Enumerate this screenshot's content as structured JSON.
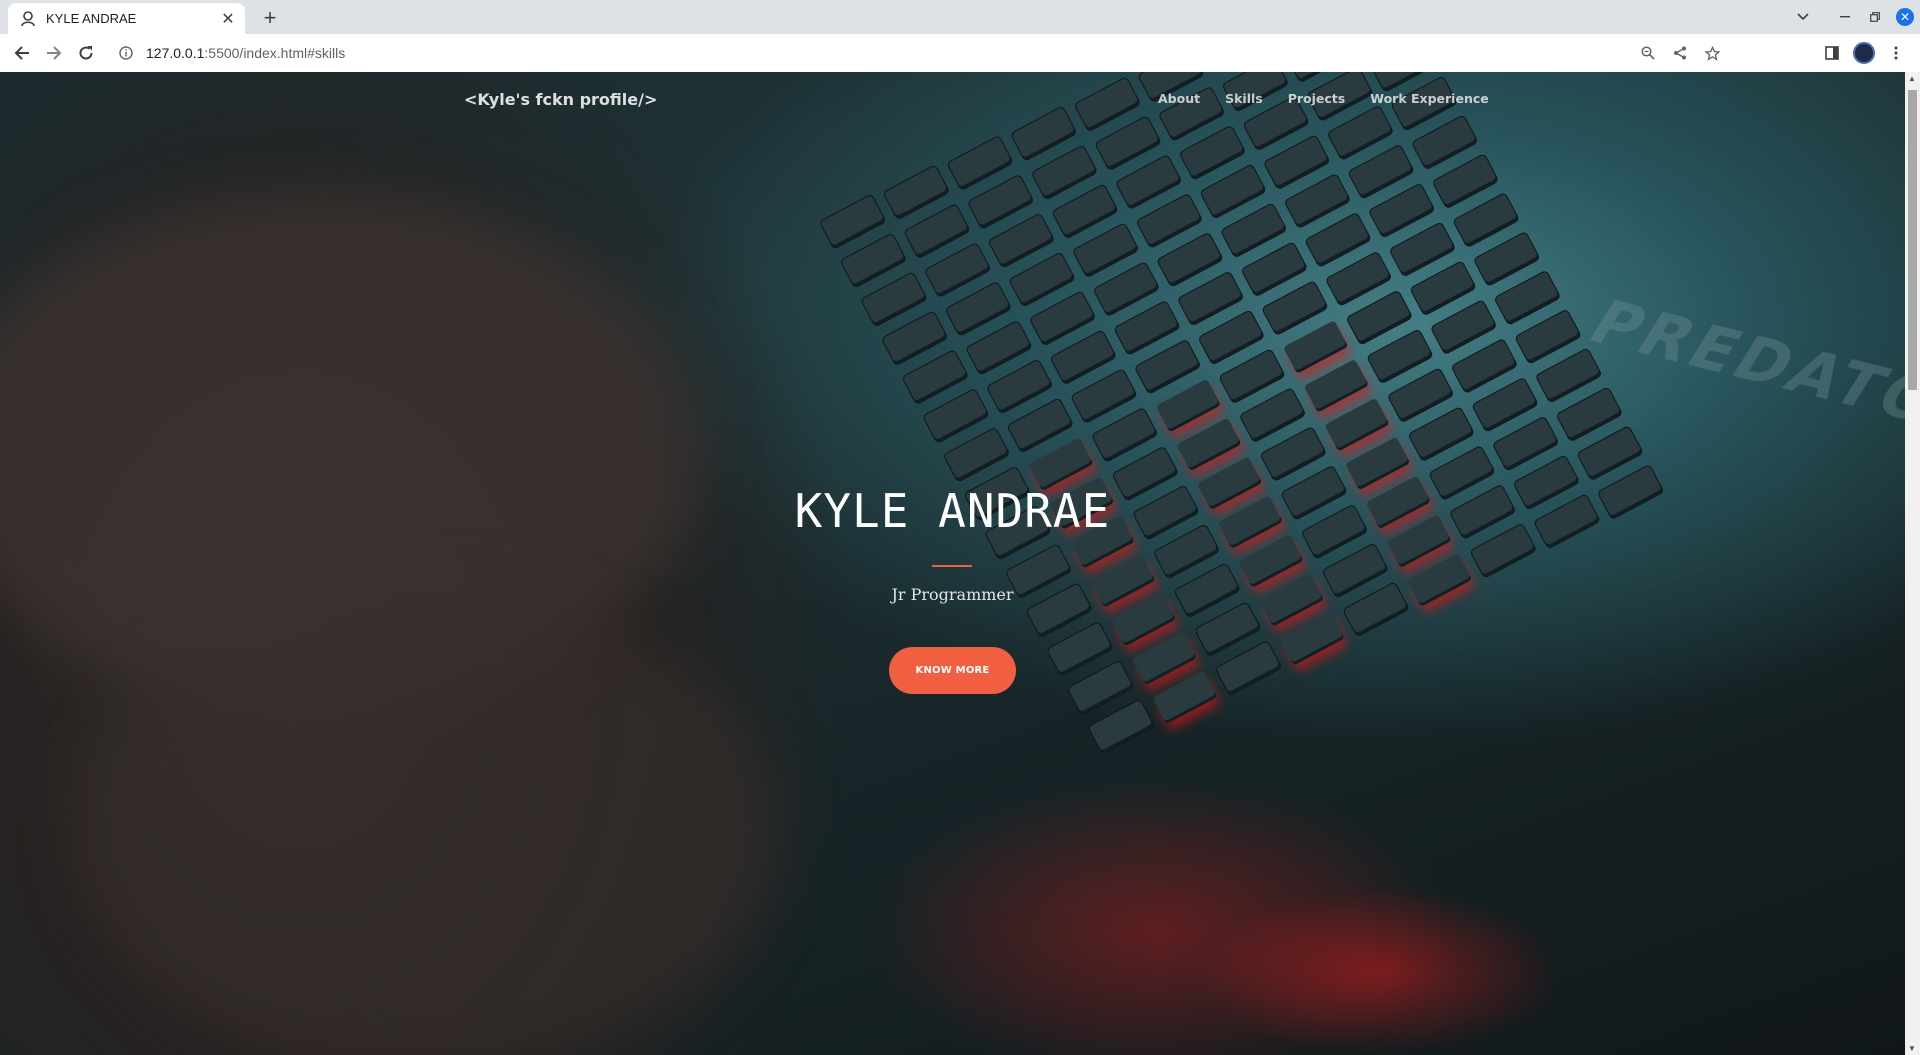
{
  "browser": {
    "tab": {
      "title": "KYLE ANDRAE",
      "close": "✕"
    },
    "new_tab": "+",
    "url": {
      "host": "127.0.0.1",
      "rest": ":5500/index.html#skills"
    }
  },
  "site": {
    "brand": "<Kyle's fckn profile/>",
    "nav": [
      "About",
      "Skills",
      "Projects",
      "Work Experience"
    ],
    "hero": {
      "title": "KYLE ANDRAE",
      "subtitle": "Jr Programmer",
      "button": "KNOW MORE"
    },
    "accent_color": "#f05f40"
  }
}
